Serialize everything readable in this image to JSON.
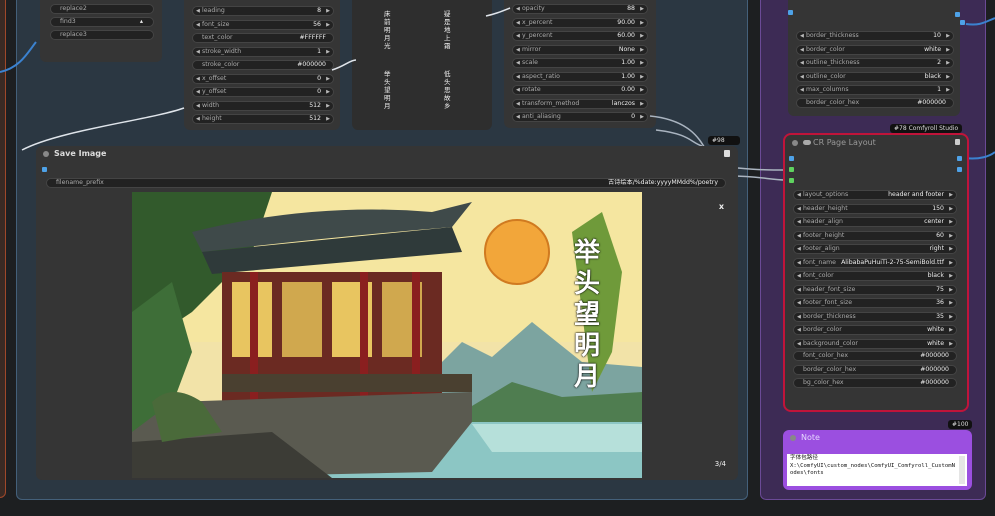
{
  "replace_node": {
    "items": [
      "replace2",
      "find3",
      "replace3"
    ]
  },
  "text_node": {
    "rows": [
      {
        "label": "leading",
        "value": "8"
      },
      {
        "label": "font_size",
        "value": "56"
      },
      {
        "label": "text_color",
        "value": "#FFFFFF"
      },
      {
        "label": "stroke_width",
        "value": "1"
      },
      {
        "label": "stroke_color",
        "value": "#000000"
      },
      {
        "label": "x_offset",
        "value": "0"
      },
      {
        "label": "y_offset",
        "value": "0"
      },
      {
        "label": "width",
        "value": "512"
      },
      {
        "label": "height",
        "value": "512"
      }
    ]
  },
  "poem_preview": {
    "col1": "床前明月光",
    "col2": "疑是地上霜",
    "col3": "举头望明月",
    "col4": "低头思故乡"
  },
  "overlay_node": {
    "rows": [
      {
        "label": "opacity",
        "value": "88"
      },
      {
        "label": "x_percent",
        "value": "90.00"
      },
      {
        "label": "y_percent",
        "value": "60.00"
      },
      {
        "label": "mirror",
        "value": "None"
      },
      {
        "label": "scale",
        "value": "1.00"
      },
      {
        "label": "aspect_ratio",
        "value": "1.00"
      },
      {
        "label": "rotate",
        "value": "0.00"
      },
      {
        "label": "transform_method",
        "value": "lanczos"
      },
      {
        "label": "anti_aliasing",
        "value": "0"
      }
    ]
  },
  "save_node": {
    "badge": "#98   ",
    "title": "Save Image",
    "filename_label": "filename_prefix",
    "filename_value": "古诗绘本/%date:yyyyMMdd%/poetry",
    "close": "x",
    "counter": "3/4",
    "image_text": "举头望明月"
  },
  "top_right_node": {
    "rows": [
      {
        "label": "border_thickness",
        "value": "10"
      },
      {
        "label": "border_color",
        "value": "white"
      },
      {
        "label": "outline_thickness",
        "value": "2"
      },
      {
        "label": "outline_color",
        "value": "black"
      },
      {
        "label": "max_columns",
        "value": "1"
      }
    ],
    "hex_label": "border_color_hex",
    "hex_value": "#000000"
  },
  "layout_node": {
    "badge": "#78 Comfyroll Studio",
    "title": "CR Page Layout",
    "rows": [
      {
        "label": "layout_options",
        "value": "header and footer"
      },
      {
        "label": "header_height",
        "value": "150"
      },
      {
        "label": "header_align",
        "value": "center"
      },
      {
        "label": "footer_height",
        "value": "60"
      },
      {
        "label": "footer_align",
        "value": "right"
      },
      {
        "label": "font_name",
        "value": "AlibabaPuHuiTi-2-75-SemiBold.ttf"
      },
      {
        "label": "font_color",
        "value": "black"
      },
      {
        "label": "header_font_size",
        "value": "75"
      },
      {
        "label": "footer_font_size",
        "value": "36"
      },
      {
        "label": "border_thickness",
        "value": "35"
      },
      {
        "label": "border_color",
        "value": "white"
      },
      {
        "label": "background_color",
        "value": "white"
      }
    ],
    "hex_rows": [
      {
        "label": "font_color_hex",
        "value": "#000000"
      },
      {
        "label": "border_color_hex",
        "value": "#000000"
      },
      {
        "label": "bg_color_hex",
        "value": "#000000"
      }
    ]
  },
  "note_node": {
    "badge": "#100",
    "title": "Note",
    "text": "字体包路径\nX:\\ComfyUI\\custom_nodes\\ComfyUI_Comfyroll_CustomNodes\\fonts"
  },
  "colors": {
    "link_color": "#dfe4ea",
    "slot_blue": "#4ea2e8",
    "slot_green": "#5fd35f",
    "layout_border": "#c0143a",
    "note_purple": "#9b4fe0",
    "group_purple": "#5a3a86"
  }
}
